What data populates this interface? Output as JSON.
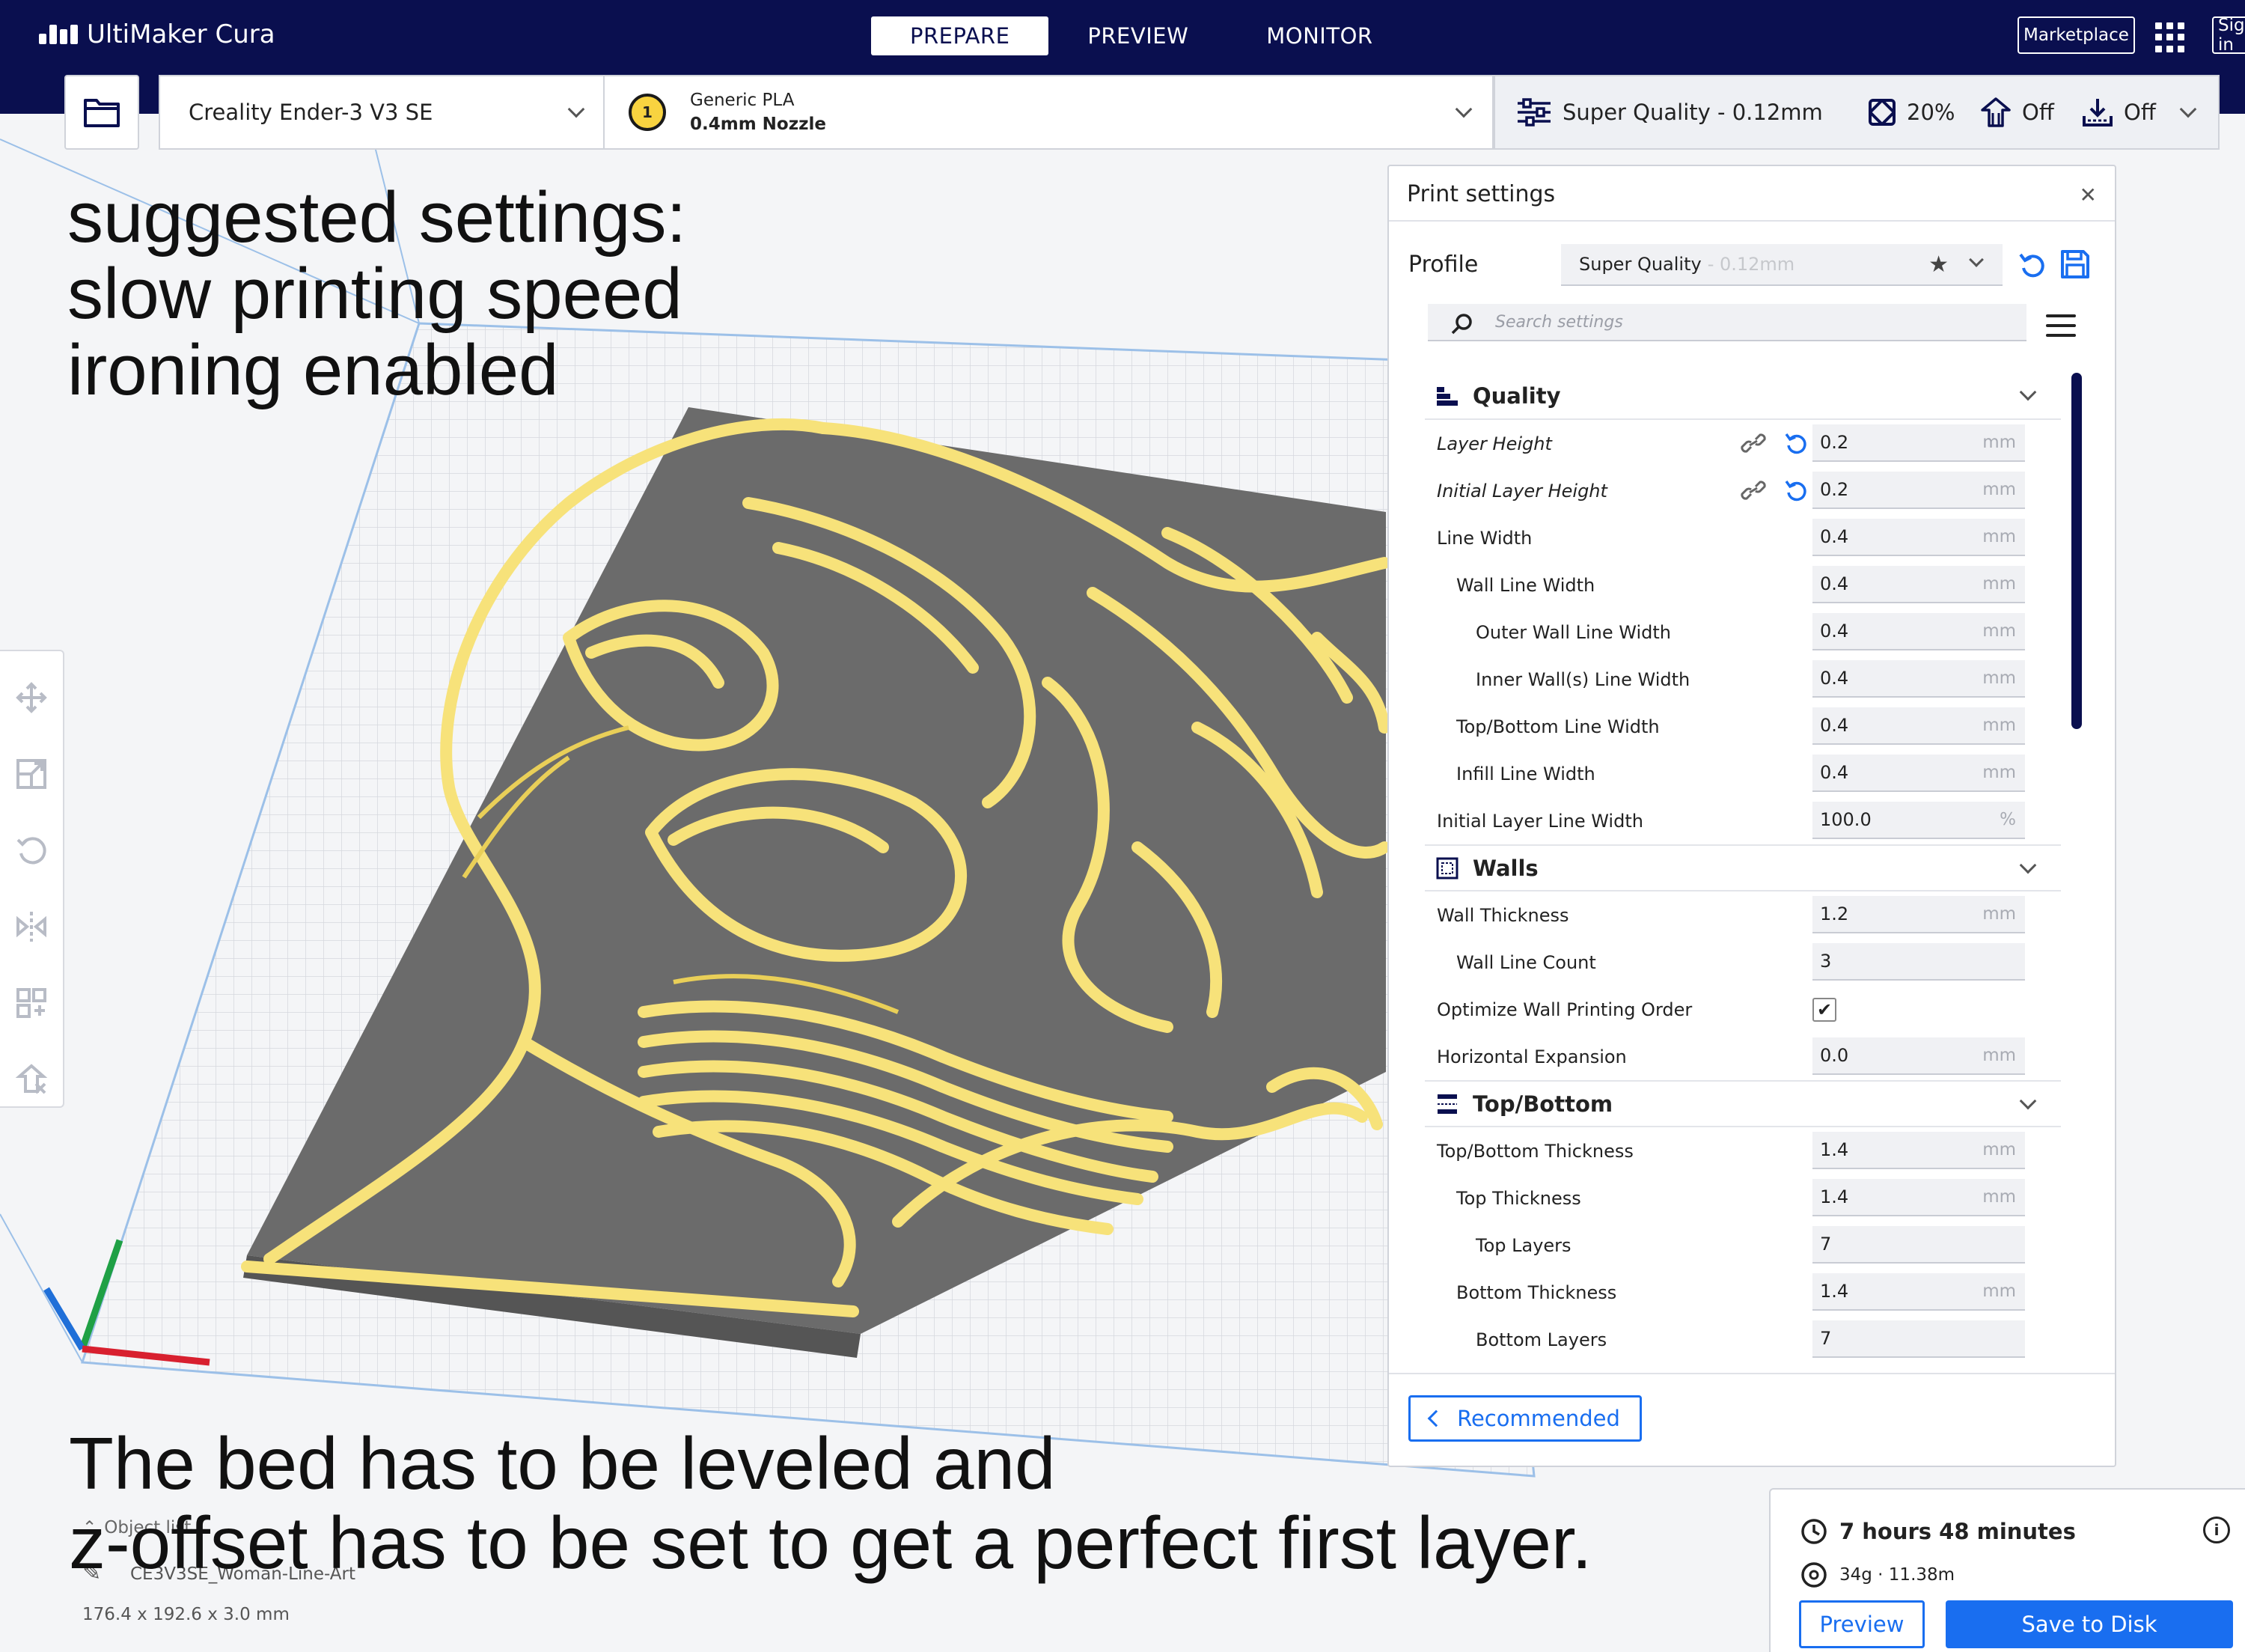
{
  "app": {
    "title": "UltiMaker Cura"
  },
  "stages": [
    {
      "label": "PREPARE",
      "active": true
    },
    {
      "label": "PREVIEW",
      "active": false
    },
    {
      "label": "MONITOR",
      "active": false
    }
  ],
  "header": {
    "marketplace_label": "Marketplace",
    "signin_label": "Sign in"
  },
  "printer": {
    "name": "Creality Ender-3 V3 SE"
  },
  "material": {
    "extruder_number": "1",
    "name": "Generic PLA",
    "nozzle": "0.4mm Nozzle",
    "color": "#f8d340"
  },
  "print_setup": {
    "profile": "Super Quality - 0.12mm",
    "infill": "20%",
    "support": "Off",
    "adhesion": "Off"
  },
  "annotation": {
    "top_lines": [
      "suggested settings:",
      "slow printing speed",
      "ironing enabled"
    ],
    "bottom_lines": [
      "The bed has to be leveled and",
      "z-offset has to be set to get a perfect first layer."
    ]
  },
  "print_settings": {
    "title": "Print settings",
    "profile_label": "Profile",
    "profile_name": "Super Quality",
    "profile_sub": "- 0.12mm",
    "search_placeholder": "Search settings",
    "recommended_label": "Recommended",
    "quality": {
      "label": "Quality",
      "rows": [
        {
          "label": "Layer Height",
          "value": "0.2",
          "unit": "mm"
        },
        {
          "label": "Initial Layer Height",
          "value": "0.2",
          "unit": "mm"
        },
        {
          "label": "Line Width",
          "value": "0.4",
          "unit": "mm"
        },
        {
          "label": "Wall Line Width",
          "value": "0.4",
          "unit": "mm"
        },
        {
          "label": "Outer Wall Line Width",
          "value": "0.4",
          "unit": "mm"
        },
        {
          "label": "Inner Wall(s) Line Width",
          "value": "0.4",
          "unit": "mm"
        },
        {
          "label": "Top/Bottom Line Width",
          "value": "0.4",
          "unit": "mm"
        },
        {
          "label": "Infill Line Width",
          "value": "0.4",
          "unit": "mm"
        },
        {
          "label": "Initial Layer Line Width",
          "value": "100.0",
          "unit": "%"
        }
      ]
    },
    "walls": {
      "label": "Walls",
      "rows": [
        {
          "label": "Wall Thickness",
          "value": "1.2",
          "unit": "mm"
        },
        {
          "label": "Wall Line Count",
          "value": "3",
          "unit": ""
        },
        {
          "label": "Optimize Wall Printing Order",
          "checked": true
        },
        {
          "label": "Horizontal Expansion",
          "value": "0.0",
          "unit": "mm"
        }
      ]
    },
    "topbottom": {
      "label": "Top/Bottom",
      "rows": [
        {
          "label": "Top/Bottom Thickness",
          "value": "1.4",
          "unit": "mm"
        },
        {
          "label": "Top Thickness",
          "value": "1.4",
          "unit": "mm"
        },
        {
          "label": "Top Layers",
          "value": "7",
          "unit": ""
        },
        {
          "label": "Bottom Thickness",
          "value": "1.4",
          "unit": "mm"
        },
        {
          "label": "Bottom Layers",
          "value": "7",
          "unit": ""
        }
      ]
    }
  },
  "objects": {
    "header": "Object list",
    "name": "CE3V3SE_Woman-Line-Art",
    "dimensions": "176.4 x 192.6 x 3.0 mm"
  },
  "estimate": {
    "time": "7 hours 48 minutes",
    "material": "34g · 11.38m"
  },
  "actions": {
    "preview_label": "Preview",
    "save_label": "Save to Disk"
  },
  "colors": {
    "navy": "#0a0f4f",
    "accent_blue": "#196ef0",
    "model_yellow": "#f7e27a",
    "plate_gray": "#6b6b6b"
  }
}
